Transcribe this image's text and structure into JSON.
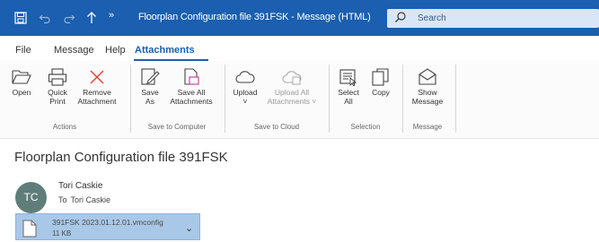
{
  "titlebar": {
    "title": "Floorplan Configuration file 391FSK  -  Message (HTML)",
    "search_placeholder": "Search",
    "icons": [
      "save-icon",
      "undo-icon",
      "redo-icon",
      "up-arrow-icon",
      "quick-access-more-icon",
      "search-icon"
    ]
  },
  "menu": {
    "items": [
      {
        "label": "File"
      },
      {
        "label": "Message"
      },
      {
        "label": "Help"
      },
      {
        "label": "Attachments",
        "active": true
      }
    ]
  },
  "ribbon": {
    "groups": [
      {
        "label": "Actions",
        "buttons": [
          "Open",
          "Quick Print",
          "Remove Attachment"
        ]
      },
      {
        "label": "Save to Computer",
        "buttons": [
          "Save As",
          "Save All Attachments"
        ]
      },
      {
        "label": "Save to Cloud",
        "buttons": [
          "Upload",
          "Upload All Attachments"
        ]
      },
      {
        "label": "Selection",
        "buttons": [
          "Select All",
          "Copy"
        ]
      },
      {
        "label": "Message",
        "buttons": [
          "Show Message"
        ]
      }
    ],
    "btn": {
      "open": [
        "Open",
        ""
      ],
      "quick_print": [
        "Quick",
        "Print"
      ],
      "remove": [
        "Remove",
        "Attachment"
      ],
      "save_as": [
        "Save",
        "As"
      ],
      "save_all": [
        "Save All",
        "Attachments"
      ],
      "upload": [
        "Upload",
        "˅"
      ],
      "upload_all": [
        "Upload All",
        "Attachments ˅"
      ],
      "select_all": [
        "Select",
        "All"
      ],
      "copy": [
        "Copy",
        ""
      ],
      "show_message": [
        "Show",
        "Message"
      ]
    }
  },
  "message": {
    "subject": "Floorplan Configuration file 391FSK",
    "avatar_initials": "TC",
    "sender": "Tori Caskie",
    "to_label": "To",
    "recipient": "Tori Caskie"
  },
  "attachment": {
    "filename": "391FSK 2023.01.12.01.vmconfig",
    "size": "11 KB"
  },
  "colors": {
    "titlebar": "#1a5fb0",
    "accent": "#1a5fb0",
    "attachment_bg": "#a9c8e8",
    "avatar_bg": "#5f7d7a",
    "remove_icon": "#e0443a"
  }
}
